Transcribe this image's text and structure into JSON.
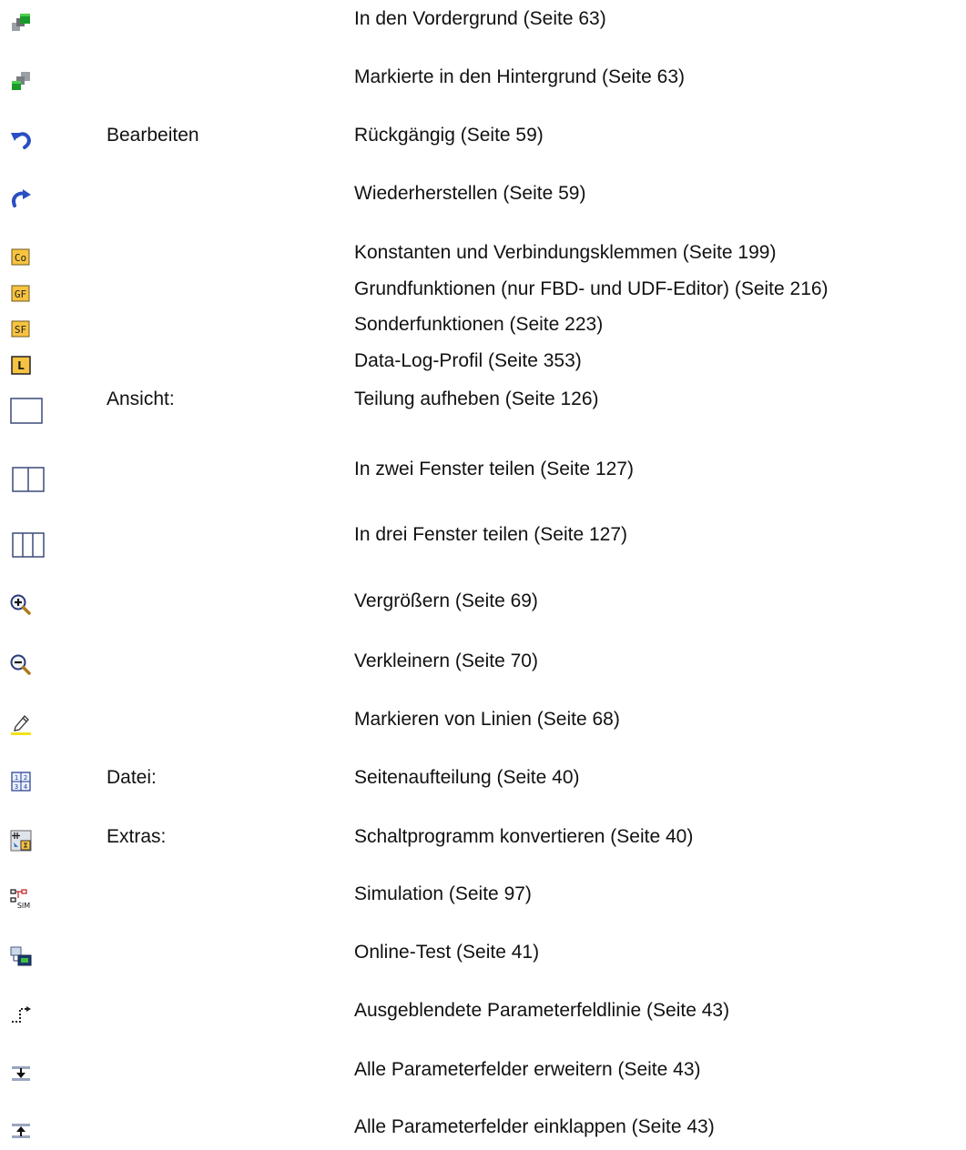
{
  "rows": [
    {
      "icon": "bring-to-front-icon",
      "menu": "",
      "label": "In den Vordergrund (Seite 63)"
    },
    {
      "icon": "send-to-back-icon",
      "menu": "",
      "label": "Markierte in den Hintergrund (Seite 63)"
    },
    {
      "icon": "undo-icon",
      "menu": "Bearbeiten",
      "label": "Rückgängig (Seite 59)"
    },
    {
      "icon": "redo-icon",
      "menu": "",
      "label": "Wiederherstellen (Seite 59)"
    },
    {
      "icon": "co-constants-icon",
      "menu": "",
      "label": "Konstanten und Verbindungsklemmen (Seite 199)",
      "icon_text": "Co"
    },
    {
      "icon": "gf-basic-functions-icon",
      "menu": "",
      "label": "Grundfunktionen (nur FBD- und UDF-Editor) (Seite 216)",
      "icon_text": "GF"
    },
    {
      "icon": "sf-special-functions-icon",
      "menu": "",
      "label": "Sonderfunktionen (Seite 223)",
      "icon_text": "SF"
    },
    {
      "icon": "l-data-log-icon",
      "menu": "",
      "label": "Data-Log-Profil (Seite 353)",
      "icon_text": "L"
    },
    {
      "icon": "single-window-icon",
      "menu": "Ansicht:",
      "label": "Teilung aufheben  (Seite 126)"
    },
    {
      "icon": "split-two-windows-icon",
      "menu": "",
      "label": "In zwei Fenster teilen (Seite 127)"
    },
    {
      "icon": "split-three-windows-icon",
      "menu": "",
      "label": "In drei Fenster teilen (Seite 127)"
    },
    {
      "icon": "zoom-in-icon",
      "menu": "",
      "label": "Vergrößern (Seite 69)"
    },
    {
      "icon": "zoom-out-icon",
      "menu": "",
      "label": "Verkleinern (Seite 70)"
    },
    {
      "icon": "highlight-lines-pen-icon",
      "menu": "",
      "label": "Markieren von Linien (Seite 68)"
    },
    {
      "icon": "page-layout-icon",
      "menu": "Datei:",
      "label": "Seitenaufteilung (Seite 40)",
      "icon_text": "12 34"
    },
    {
      "icon": "convert-program-icon",
      "menu": "Extras:",
      "label": "Schaltprogramm konvertieren (Seite 40)"
    },
    {
      "icon": "simulation-icon",
      "menu": "",
      "label": "Simulation (Seite 97)",
      "icon_text": "SIM"
    },
    {
      "icon": "online-test-icon",
      "menu": "",
      "label": "Online-Test (Seite 41)"
    },
    {
      "icon": "hidden-parameter-line-icon",
      "menu": "",
      "label": "Ausgeblendete Parameterfeldlinie (Seite 43)"
    },
    {
      "icon": "expand-all-parameters-icon",
      "menu": "",
      "label": "Alle Parameterfelder erweitern (Seite 43)"
    },
    {
      "icon": "collapse-all-parameters-icon",
      "menu": "",
      "label": "Alle Parameterfelder einklappen (Seite 43)"
    }
  ]
}
